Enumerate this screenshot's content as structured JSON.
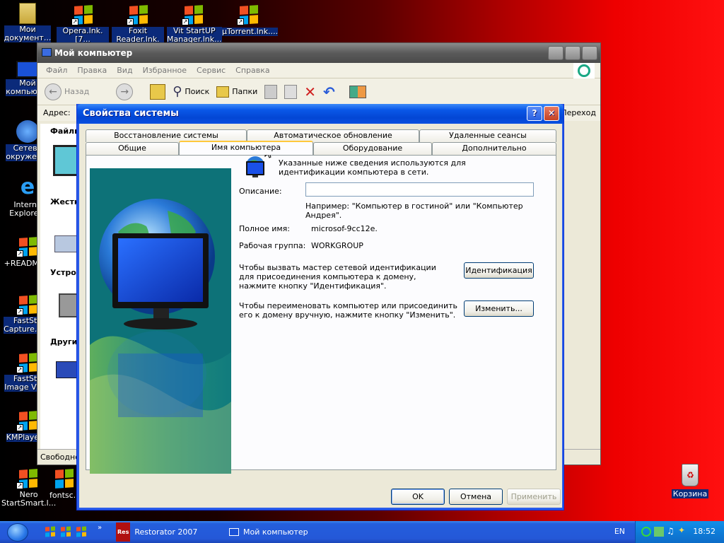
{
  "desktop": {
    "icons": [
      {
        "label": "Мои\nдокумент..."
      },
      {
        "label": "Opera.lnk.[7..."
      },
      {
        "label": "Foxit\nReader.lnk.[..."
      },
      {
        "label": "Vit StartUP\nManager.lnk..."
      },
      {
        "label": "µTorrent.lnk...."
      },
      {
        "label": "Мой\nкомпьют..."
      },
      {
        "label": "Сетево\nокружен..."
      },
      {
        "label": "Interne\nExplore..."
      },
      {
        "label": "+README..."
      },
      {
        "label": "FastSto\nCapture.ln..."
      },
      {
        "label": "FastSto\nImage Vie..."
      },
      {
        "label": "KMPlayer..."
      },
      {
        "label": "Nero\nStartSmart.l..."
      },
      {
        "label": "fontsc..."
      }
    ],
    "recycle_bin": "Корзина"
  },
  "explorer": {
    "title": "Мой компьютер",
    "menu": [
      "Файл",
      "Правка",
      "Вид",
      "Избранное",
      "Сервис",
      "Справка"
    ],
    "toolbar": {
      "back": "Назад",
      "search": "Поиск",
      "folders": "Папки"
    },
    "address_label": "Адрес:",
    "go_label": "Переход",
    "left_sections": [
      "Файлы",
      "Жестк",
      "Устро",
      "Други"
    ],
    "status": "Свободно:"
  },
  "dialog": {
    "title": "Свойства системы",
    "tabs_top": [
      "Восстановление системы",
      "Автоматическое обновление",
      "Удаленные сеансы"
    ],
    "tabs_bottom": [
      "Общие",
      "Имя компьютера",
      "Оборудование",
      "Дополнительно"
    ],
    "intro": "Указанные ниже сведения используются для идентификации компьютера в сети.",
    "description_label": "Описание:",
    "description_value": "",
    "example": "Например: \"Компьютер в гостиной\" или \"Компьютер Андрея\".",
    "fullname_label": "Полное имя:",
    "fullname_value": "microsof-9cc12e.",
    "workgroup_label": "Рабочая группа:",
    "workgroup_value": "WORKGROUP",
    "wizard_text": "Чтобы вызвать мастер сетевой идентификации для присоединения компьютера к домену, нажмите кнопку \"Идентификация\".",
    "ident_button": "Идентификация",
    "rename_text": "Чтобы переименовать компьютер или присоединить его к домену вручную, нажмите кнопку \"Изменить\".",
    "change_button": "Изменить...",
    "ok": "OK",
    "cancel": "Отмена",
    "apply": "Применить"
  },
  "taskbar": {
    "tasks": [
      "Restorator 2007",
      "Мой компьютер"
    ],
    "lang": "EN",
    "clock": "18:52"
  }
}
